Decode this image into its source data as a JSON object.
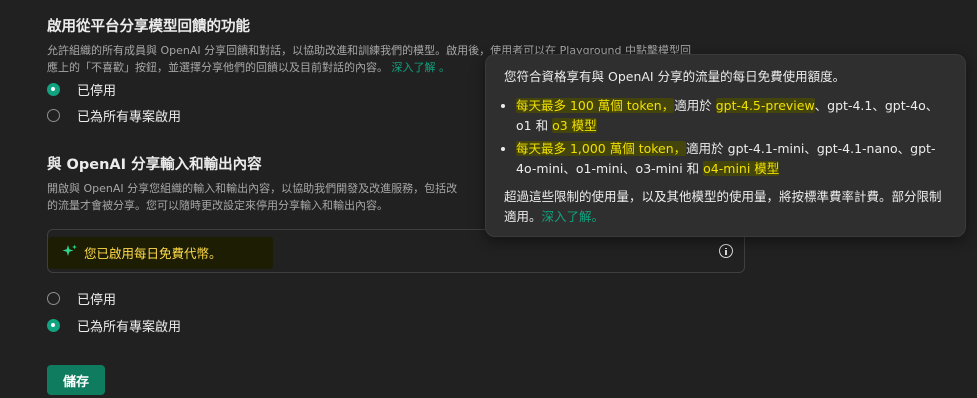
{
  "section_feedback": {
    "title": "啟用從平台分享模型回饋的功能",
    "description_1": "允許組織的所有成員與 OpenAI 分享回饋和對話，以協助改進和訓練我們的模型。啟用後，使用者可以在 Playground 中點擊模型回",
    "description_2": "應上的「不喜歡」按鈕，並選擇分享他們的回饋以及目前對話的內容。",
    "learn_more": "深入了解 。",
    "options": [
      {
        "label": "已停用",
        "selected": true
      },
      {
        "label": "已為所有專案啟用",
        "selected": false
      }
    ]
  },
  "section_sharing": {
    "title": "與 OpenAI 分享輸入和輸出內容",
    "description_1": "開啟與 OpenAI 分享您組織的輸入和輸出內容，以協助我們開發及改進服務，包括改",
    "description_2": "的流量才會被分享。您可以隨時更改設定來停用分享輸入和輸出內容。",
    "banner_text": "您已啟用每日免費代幣。",
    "options": [
      {
        "label": "已停用",
        "selected": false
      },
      {
        "label": "已為所有專案啟用",
        "selected": true
      }
    ]
  },
  "save_label": "儲存",
  "tooltip": {
    "intro": "您符合資格享有與 OpenAI 分享的流量的每日免費使用額度。",
    "item1_hl": "每天最多 100 萬個 token，",
    "item1_mid": "適用於 ",
    "item1_model": "gpt-4.5-preview",
    "item1_rest1": "、gpt-4.1、gpt-4o、",
    "item1_rest2": "o1 和 ",
    "item1_model2": "o3 模型",
    "item2_hl": "每天最多 1,000 萬個 token，",
    "item2_mid1": "適用於 gpt-4.1-mini、gpt-4.1-nano、gpt-",
    "item2_mid2": "4o-mini、o1-mini、o3-mini 和 ",
    "item2_model": "o4-mini 模型",
    "footer": "超過這些限制的使用量，以及其他模型的使用量，將按標準費率計費。部分限制適用。",
    "learn_more": "深入了解。"
  },
  "colors": {
    "background": "#212121",
    "accent_green": "#10a37f",
    "highlight_yellow": "#f0e000",
    "tooltip_bg": "#2f2f2f"
  },
  "icons": {
    "sparkle": "sparkle-icon",
    "info": "info-icon"
  }
}
